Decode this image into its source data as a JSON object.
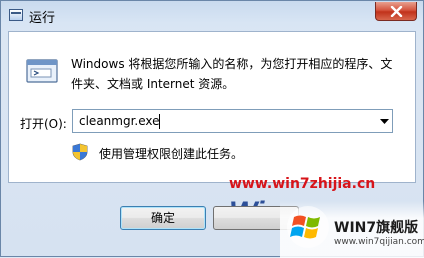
{
  "window": {
    "title": "运行"
  },
  "dialog": {
    "description": "Windows 将根据您所输入的名称，为您打开相应的程序、文件夹、文档或 Internet 资源。",
    "open_label": "打开(O):",
    "command_value": "cleanmgr.exe",
    "admin_note": "使用管理权限创建此任务。"
  },
  "buttons": {
    "ok_label": "确定"
  },
  "watermark": {
    "url": "www.win7zhijia.cn",
    "logo_text": "Win",
    "brand_name": "WIN7旗舰版",
    "brand_url": "www.win7qijian.com"
  },
  "colors": {
    "watermark_red": "#d7141a",
    "close_red": "#c1321b"
  },
  "icons": {
    "window": "run-app-icon",
    "close": "close-icon",
    "shield": "uac-shield-icon",
    "dropdown": "dropdown-arrow-icon"
  }
}
